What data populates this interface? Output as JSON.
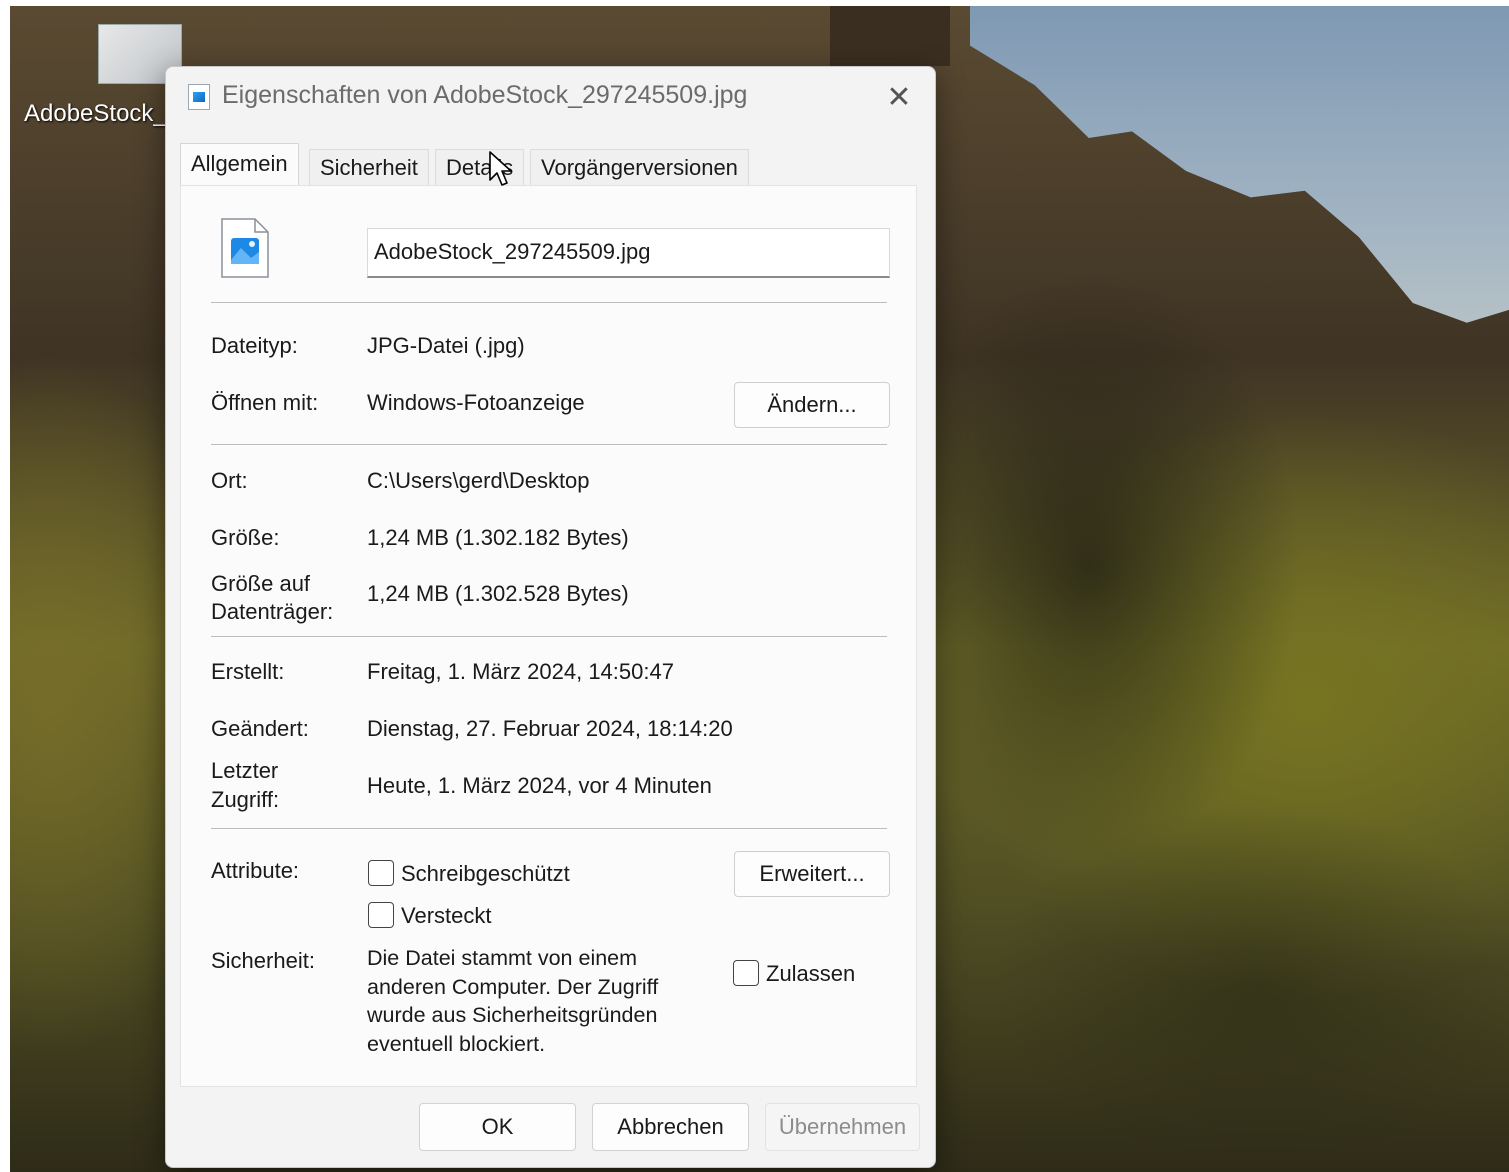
{
  "desktop": {
    "icon_label": "AdobeStock_"
  },
  "dialog": {
    "title": "Eigenschaften von AdobeStock_297245509.jpg",
    "tabs": [
      {
        "label": "Allgemein",
        "active": true
      },
      {
        "label": "Sicherheit",
        "active": false
      },
      {
        "label": "Details",
        "active": false
      },
      {
        "label": "Vorgängerversionen",
        "active": false
      }
    ],
    "filename": "AdobeStock_297245509.jpg",
    "fields": {
      "dateityp_label": "Dateityp:",
      "dateityp_value": "JPG-Datei (.jpg)",
      "oeffnen_label": "Öffnen mit:",
      "oeffnen_value": "Windows-Fotoanzeige",
      "aendern_button": "Ändern...",
      "ort_label": "Ort:",
      "ort_value": "C:\\Users\\gerd\\Desktop",
      "groesse_label": "Größe:",
      "groesse_value": "1,24 MB (1.302.182 Bytes)",
      "groesse_disk_label_1": "Größe auf",
      "groesse_disk_label_2": "Datenträger:",
      "groesse_disk_value": "1,24 MB (1.302.528 Bytes)",
      "erstellt_label": "Erstellt:",
      "erstellt_value": "Freitag, 1. März 2024, 14:50:47",
      "geaendert_label": "Geändert:",
      "geaendert_value": "Dienstag, 27. Februar 2024, 18:14:20",
      "zugriff_label_1": "Letzter",
      "zugriff_label_2": "Zugriff:",
      "zugriff_value": "Heute, 1. März 2024, vor 4 Minuten",
      "attribute_label": "Attribute:",
      "schreibgeschuetzt": "Schreibgeschützt",
      "versteckt": "Versteckt",
      "erweitert_button": "Erweitert...",
      "sicherheit_label": "Sicherheit:",
      "sicherheit_text": "Die Datei stammt von einem anderen Computer. Der Zugriff wurde aus Sicherheitsgründen eventuell blockiert.",
      "zulassen": "Zulassen"
    },
    "checkboxes": {
      "schreibgeschuetzt": false,
      "versteckt": false,
      "zulassen": false
    },
    "footer": {
      "ok": "OK",
      "cancel": "Abbrechen",
      "apply": "Übernehmen"
    },
    "close_icon": "close-icon"
  }
}
